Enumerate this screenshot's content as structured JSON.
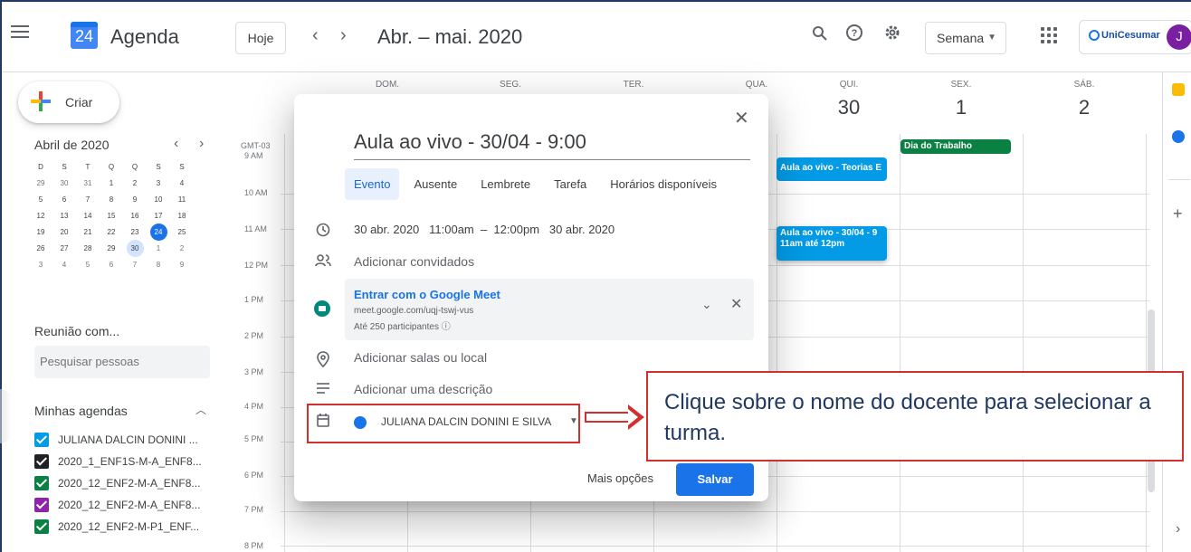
{
  "header": {
    "app_title": "Agenda",
    "logo_day": "24",
    "today_label": "Hoje",
    "date_range": "Abr. – mai. 2020",
    "view_label": "Semana",
    "brand_label": "UniCesumar",
    "avatar_letter": "J"
  },
  "sidebar": {
    "create_label": "Criar",
    "mini_month": "Abril de 2020",
    "weekday_letters": [
      "D",
      "S",
      "T",
      "Q",
      "Q",
      "S",
      "S"
    ],
    "weeks": [
      [
        "29",
        "30",
        "31",
        "1",
        "2",
        "3",
        "4"
      ],
      [
        "5",
        "6",
        "7",
        "8",
        "9",
        "10",
        "11"
      ],
      [
        "12",
        "13",
        "14",
        "15",
        "16",
        "17",
        "18"
      ],
      [
        "19",
        "20",
        "21",
        "22",
        "23",
        "24",
        "25"
      ],
      [
        "26",
        "27",
        "28",
        "29",
        "30",
        "1",
        "2"
      ],
      [
        "3",
        "4",
        "5",
        "6",
        "7",
        "8",
        "9"
      ]
    ],
    "reuniao_label": "Reunião com...",
    "search_placeholder": "Pesquisar pessoas",
    "minhas_label": "Minhas agendas",
    "calendars": [
      {
        "name": "JULIANA DALCIN DONINI ...",
        "color": "#039be5"
      },
      {
        "name": "2020_1_ENF1S-M-A_ENF8...",
        "color": "#202124"
      },
      {
        "name": "2020_12_ENF2-M-A_ENF8...",
        "color": "#0b8043"
      },
      {
        "name": "2020_12_ENF2-M-A_ENF8...",
        "color": "#8e24aa"
      },
      {
        "name": "2020_12_ENF2-M-P1_ENF...",
        "color": "#0b8043"
      }
    ]
  },
  "grid": {
    "days": [
      {
        "abbr": "DOM.",
        "num": ""
      },
      {
        "abbr": "SEG.",
        "num": ""
      },
      {
        "abbr": "TER.",
        "num": ""
      },
      {
        "abbr": "QUA.",
        "num": ""
      },
      {
        "abbr": "QUI.",
        "num": "30"
      },
      {
        "abbr": "SEX.",
        "num": "1"
      },
      {
        "abbr": "SÁB.",
        "num": "2"
      }
    ],
    "timezone": "GMT-03",
    "times": [
      "9 AM",
      "10 AM",
      "11 AM",
      "12 PM",
      "1 PM",
      "2 PM",
      "3 PM",
      "4 PM",
      "5 PM",
      "6 PM",
      "7 PM",
      "8 PM"
    ],
    "events": {
      "holiday": "Dia do Trabalho",
      "event1": "Aula ao vivo - Teorias E",
      "event2_title": "Aula ao vivo - 30/04 - 9",
      "event2_time": "11am até 12pm"
    }
  },
  "dialog": {
    "title": "Aula ao vivo - 30/04 - 9:00",
    "tabs": [
      "Evento",
      "Ausente",
      "Lembrete",
      "Tarefa",
      "Horários disponíveis"
    ],
    "datetime": "30 abr. 2020   11:00am  –  12:00pm   30 abr. 2020",
    "add_guests": "Adicionar convidados",
    "meet_link": "Entrar com o Google Meet",
    "meet_url": "meet.google.com/uqj-tswj-vus",
    "meet_participants": "Até 250 participantes ⓘ",
    "add_rooms": "Adicionar salas ou local",
    "add_description": "Adicionar uma descrição",
    "calendar_owner": "JULIANA DALCIN DONINI E SILVA",
    "more_options": "Mais opções",
    "save": "Salvar"
  },
  "callout": {
    "text": "Clique sobre o nome do docente para selecionar a turma."
  },
  "colors": {
    "accent": "#1a73e8",
    "annotation": "#d32f2f",
    "event_blue": "#039be5",
    "holiday_green": "#0b8043"
  }
}
